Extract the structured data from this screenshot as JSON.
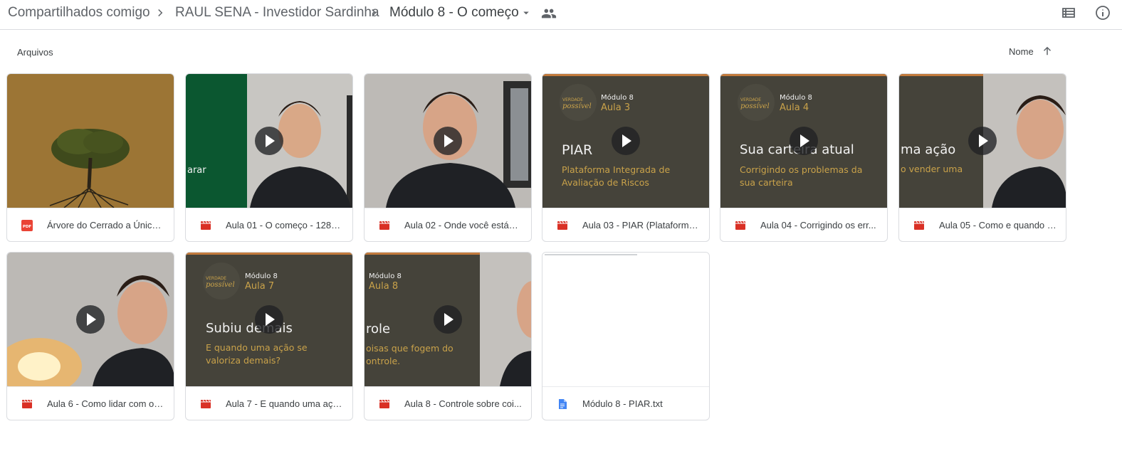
{
  "breadcrumb": {
    "items": [
      "Compartilhados comigo",
      "RAUL SENA - Investidor Sardinha",
      "Módulo 8 - O começo"
    ]
  },
  "toolbar": {
    "list_view_icon": "list-view-icon",
    "details_icon": "info-icon"
  },
  "files_section": {
    "label": "Arquivos",
    "sort_label": "Nome",
    "sort_direction": "ascending"
  },
  "files": [
    {
      "name": "Árvore do Cerrado a Única ...",
      "type": "pdf"
    },
    {
      "name": "Aula 01 - O começo - 1280...",
      "type": "video"
    },
    {
      "name": "Aula 02 - Onde você está_ -...",
      "type": "video"
    },
    {
      "name": "Aula 03 - PIAR (Plataforma...",
      "type": "video"
    },
    {
      "name": "Aula 04 - Corrigindo os err...",
      "type": "video"
    },
    {
      "name": "Aula 05 - Como e quando v...",
      "type": "video"
    },
    {
      "name": "Aula 6 - Como lidar com os...",
      "type": "video"
    },
    {
      "name": "Aula 7 - E quando uma açã...",
      "type": "video"
    },
    {
      "name": "Aula 8 - Controle sobre coi...",
      "type": "video"
    },
    {
      "name": "Módulo 8 - PIAR.txt",
      "type": "doc"
    }
  ],
  "thumbnails": {
    "t2": {
      "line1": "arar"
    },
    "t4": {
      "module": "Módulo 8",
      "lesson": "Aula 3",
      "title": "PIAR",
      "sub1": "Plataforma Integrada de",
      "sub2": "Avaliação de Riscos"
    },
    "t5": {
      "module": "Módulo 8",
      "lesson": "Aula 4",
      "title": "Sua carteira atual",
      "sub1": "Corrigindo os problemas da",
      "sub2": "sua carteira"
    },
    "t6": {
      "title": "ma ação",
      "sub1": "o vender uma"
    },
    "t8": {
      "module": "Módulo 8",
      "lesson": "Aula 7",
      "title": "Subiu demais",
      "sub1": "E quando uma ação se",
      "sub2": "valoriza demais?"
    },
    "t9": {
      "module": "Módulo 8",
      "lesson": "Aula 8",
      "title": "role",
      "sub1": "oisas que fogem do",
      "sub2": "ontrole."
    }
  },
  "colors": {
    "pdf_red": "#ea4335",
    "video_red": "#d93025",
    "doc_blue": "#4285f4",
    "slide_bg": "#45433a",
    "slide_gold": "#c9a24a",
    "tree_bg": "#9c7535",
    "green_panel": "#0b5730"
  }
}
